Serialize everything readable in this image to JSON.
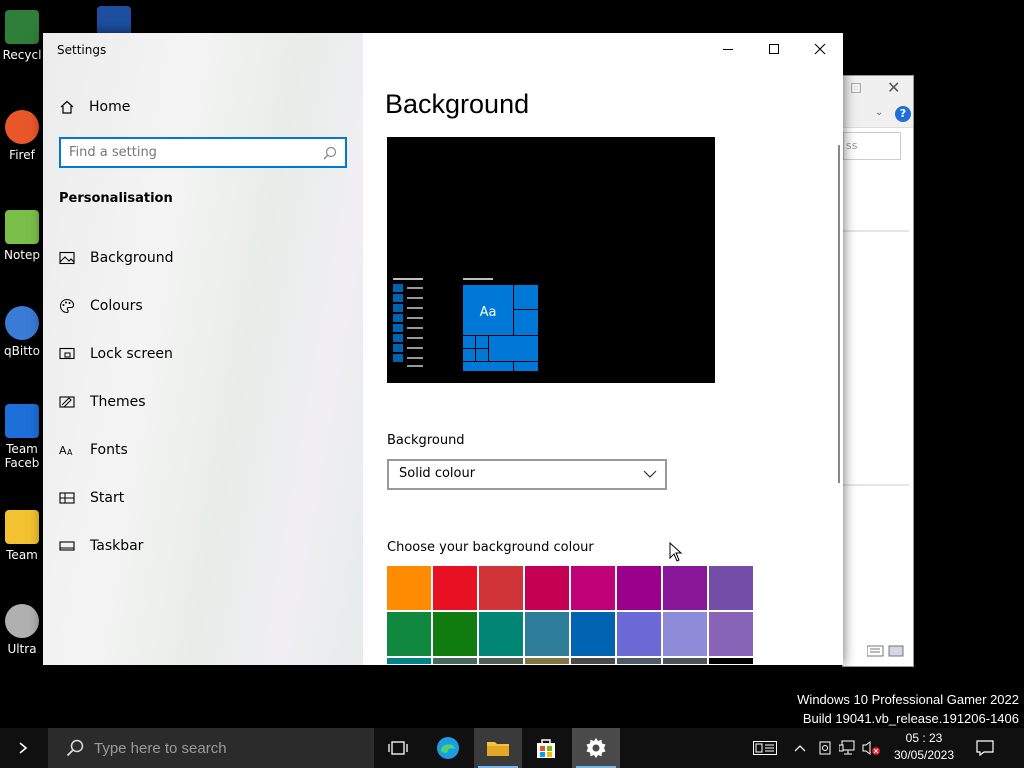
{
  "desktop": {
    "icons": [
      {
        "label": "Recycl",
        "color": "#3a8f3a"
      },
      {
        "label": "Firef",
        "color": "#e8572a"
      },
      {
        "label": "Notep",
        "color": "#7bbf4a"
      },
      {
        "label": "qBitto",
        "color": "#3a7bd5"
      },
      {
        "label": "Team Faceb",
        "color": "#1e6fd9"
      },
      {
        "label": "Team",
        "color": "#f2c230"
      },
      {
        "label": "Ultra",
        "color": "#b0b0b0"
      }
    ],
    "watermark": {
      "line1": "Windows 10 Professional Gamer 2022",
      "line2": "Build 19041.vb_release.191206-1406"
    }
  },
  "background_window": {
    "address_fragment": "ss",
    "help_label": "?"
  },
  "settings": {
    "title": "Settings",
    "home_label": "Home",
    "search_placeholder": "Find a setting",
    "section": "Personalisation",
    "nav": [
      {
        "label": "Background",
        "icon": "picture-icon"
      },
      {
        "label": "Colours",
        "icon": "palette-icon"
      },
      {
        "label": "Lock screen",
        "icon": "lock-screen-icon"
      },
      {
        "label": "Themes",
        "icon": "themes-icon"
      },
      {
        "label": "Fonts",
        "icon": "fonts-icon"
      },
      {
        "label": "Start",
        "icon": "start-icon"
      },
      {
        "label": "Taskbar",
        "icon": "taskbar-icon"
      }
    ],
    "page_title": "Background",
    "preview_tile_text": "Aa",
    "background_label": "Background",
    "background_value": "Solid colour",
    "choose_label": "Choose your background colour",
    "swatches": [
      "#ff8c00",
      "#e81123",
      "#d13438",
      "#c30052",
      "#bf0077",
      "#9a0089",
      "#881798",
      "#744da9",
      "#10893e",
      "#107c10",
      "#018574",
      "#2d7d9a",
      "#0063b1",
      "#6b69d6",
      "#8e8cd8",
      "#8764b8",
      "#038387",
      "#486860",
      "#525e54",
      "#847545",
      "#4c4a48",
      "#515c6b",
      "#4a5459",
      "#000000"
    ]
  },
  "taskbar": {
    "search_placeholder": "Type here to search",
    "time": "05 : 23",
    "date": "30/05/2023"
  }
}
